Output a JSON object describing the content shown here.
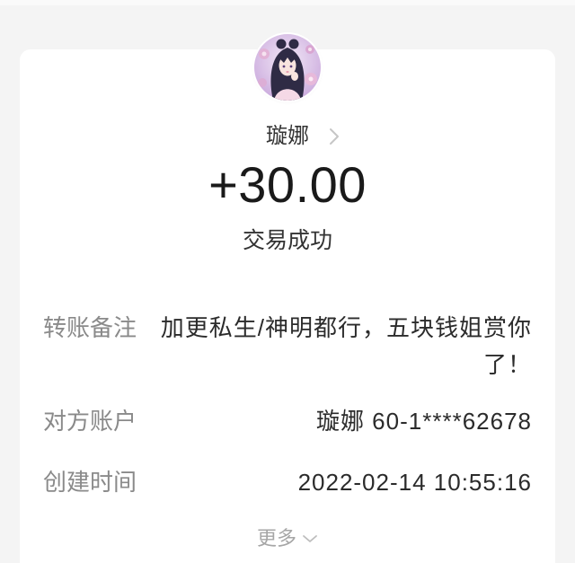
{
  "theme": {
    "page_bg": "#f4f4f4",
    "card_bg": "#ffffff",
    "label_color": "#8a8a8a",
    "value_color": "#2b2b2b",
    "amount_color": "#1a1a1a",
    "muted_color": "#a6a6a6"
  },
  "payee": {
    "name": "璇娜",
    "avatar": "avatar-image",
    "chevron_icon": "chevron-right-icon"
  },
  "transaction": {
    "amount": "+30.00",
    "status": "交易成功"
  },
  "details": [
    {
      "label": "转账备注",
      "value": "加更私生/神明都行，五块钱姐赏你了！"
    },
    {
      "label": "对方账户",
      "value": "璇娜 60-1****62678"
    },
    {
      "label": "创建时间",
      "value": "2022-02-14 10:55:16"
    }
  ],
  "more": {
    "label": "更多",
    "icon": "chevron-down-icon"
  }
}
